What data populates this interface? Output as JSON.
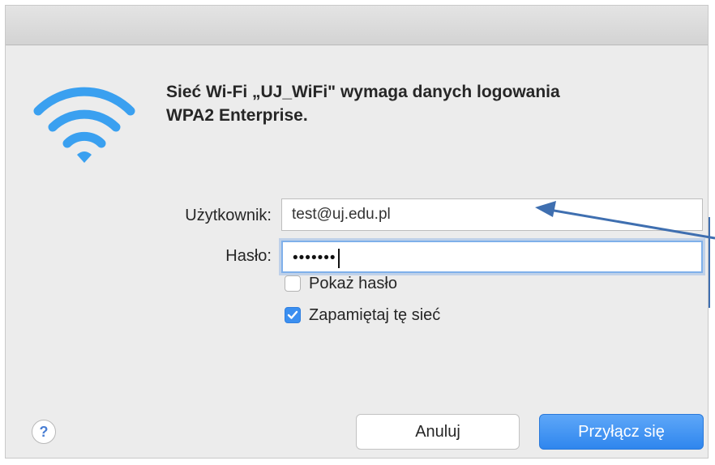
{
  "dialog": {
    "heading": "Sieć Wi-Fi „UJ_WiFi\" wymaga danych logowania\nWPA2 Enterprise.",
    "icon": "wifi-icon"
  },
  "form": {
    "username_label": "Użytkownik:",
    "username_value": "test@uj.edu.pl",
    "password_label": "Hasło:",
    "password_masked": "•••••••",
    "show_password_label": "Pokaż hasło",
    "show_password_checked": false,
    "remember_label": "Zapamiętaj tę sieć",
    "remember_checked": true
  },
  "buttons": {
    "help": "?",
    "cancel": "Anuluj",
    "connect": "Przyłącz się"
  },
  "colors": {
    "accent": "#3b8ff0",
    "wifi": "#3aa0f0",
    "callout": "#3f6fb0"
  }
}
